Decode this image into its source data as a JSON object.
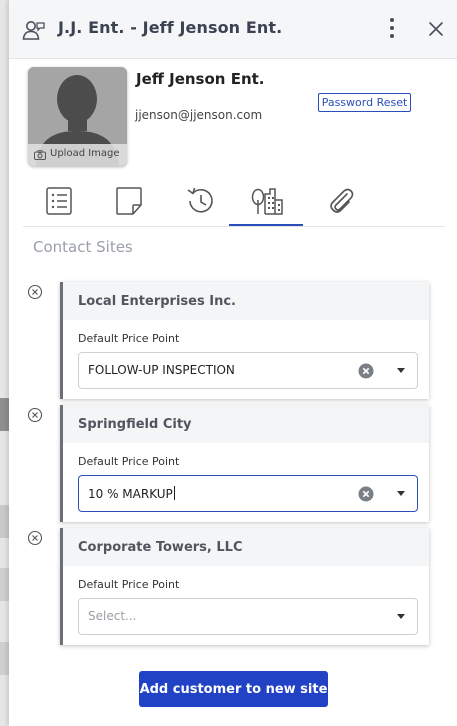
{
  "header": {
    "title": "J.J. Ent. - Jeff Jenson Ent.",
    "icon": "contact-person-icon",
    "menu_icon": "more-vertical-icon",
    "close_icon": "close-icon"
  },
  "profile": {
    "name": "Jeff Jenson Ent.",
    "email": "jjenson@jjenson.com",
    "password_reset_label": "Password Reset",
    "upload_label": "Upload Image"
  },
  "tabs": [
    {
      "icon": "list-icon",
      "active": false
    },
    {
      "icon": "note-icon",
      "active": false
    },
    {
      "icon": "history-icon",
      "active": false
    },
    {
      "icon": "sites-icon",
      "active": true
    },
    {
      "icon": "attachment-icon",
      "active": false
    }
  ],
  "section": {
    "title": "Contact Sites",
    "sites": [
      {
        "name": "Local Enterprises Inc.",
        "field_label": "Default Price Point",
        "value": "FOLLOW-UP INSPECTION",
        "placeholder": ""
      },
      {
        "name": "Springfield City",
        "field_label": "Default Price Point",
        "value": "10 % MARKUP",
        "placeholder": ""
      },
      {
        "name": "Corporate Towers, LLC",
        "field_label": "Default Price Point",
        "value": "",
        "placeholder": "Select..."
      }
    ]
  },
  "add_button_label": "Add customer to new site",
  "colors": {
    "accent": "#2b4fb8",
    "button": "#2142c4",
    "header_bg": "#f5f6f8",
    "card_border": "#6b6f76"
  }
}
